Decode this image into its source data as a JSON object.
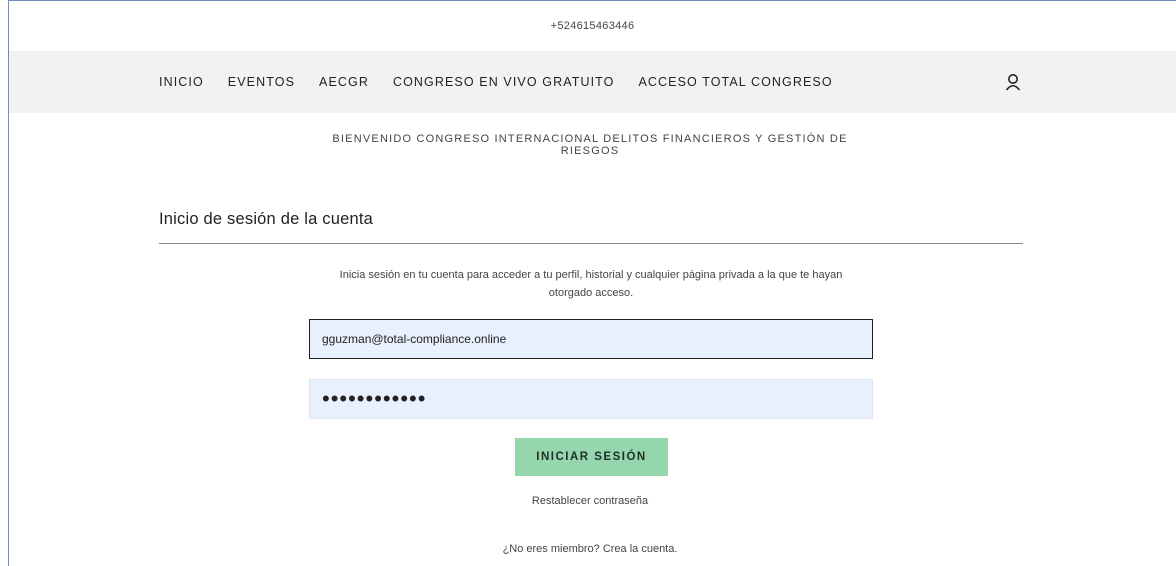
{
  "topbar": {
    "phone": "+524615463446"
  },
  "nav": {
    "items": [
      "INICIO",
      "EVENTOS",
      "AECGR",
      "CONGRESO EN VIVO GRATUITO",
      "ACCESO TOTAL CONGRESO"
    ],
    "user_icon": "user-icon"
  },
  "welcome": {
    "line1": "BIENVENIDO CONGRESO INTERNACIONAL DELITOS FINANCIEROS Y GESTIÓN DE",
    "line2": "RIESGOS"
  },
  "login": {
    "title": "Inicio de sesión de la cuenta",
    "intro_line1": "Inicia sesión en tu cuenta para acceder a tu perfil, historial y cualquier página privada a la que te hayan",
    "intro_line2": "otorgado acceso.",
    "email_value": "gguzman@total-compliance.online",
    "password_value": "••••••••••••",
    "submit_label": "INICIAR SESIÓN",
    "reset_link": "Restablecer contraseña",
    "signup_link": "¿No eres miembro? Crea la cuenta."
  },
  "colors": {
    "nav_bg": "#f2f2f2",
    "input_bg": "#e8f0fe",
    "button_bg": "#96d6ad",
    "frame_border": "#6f8fbf"
  }
}
